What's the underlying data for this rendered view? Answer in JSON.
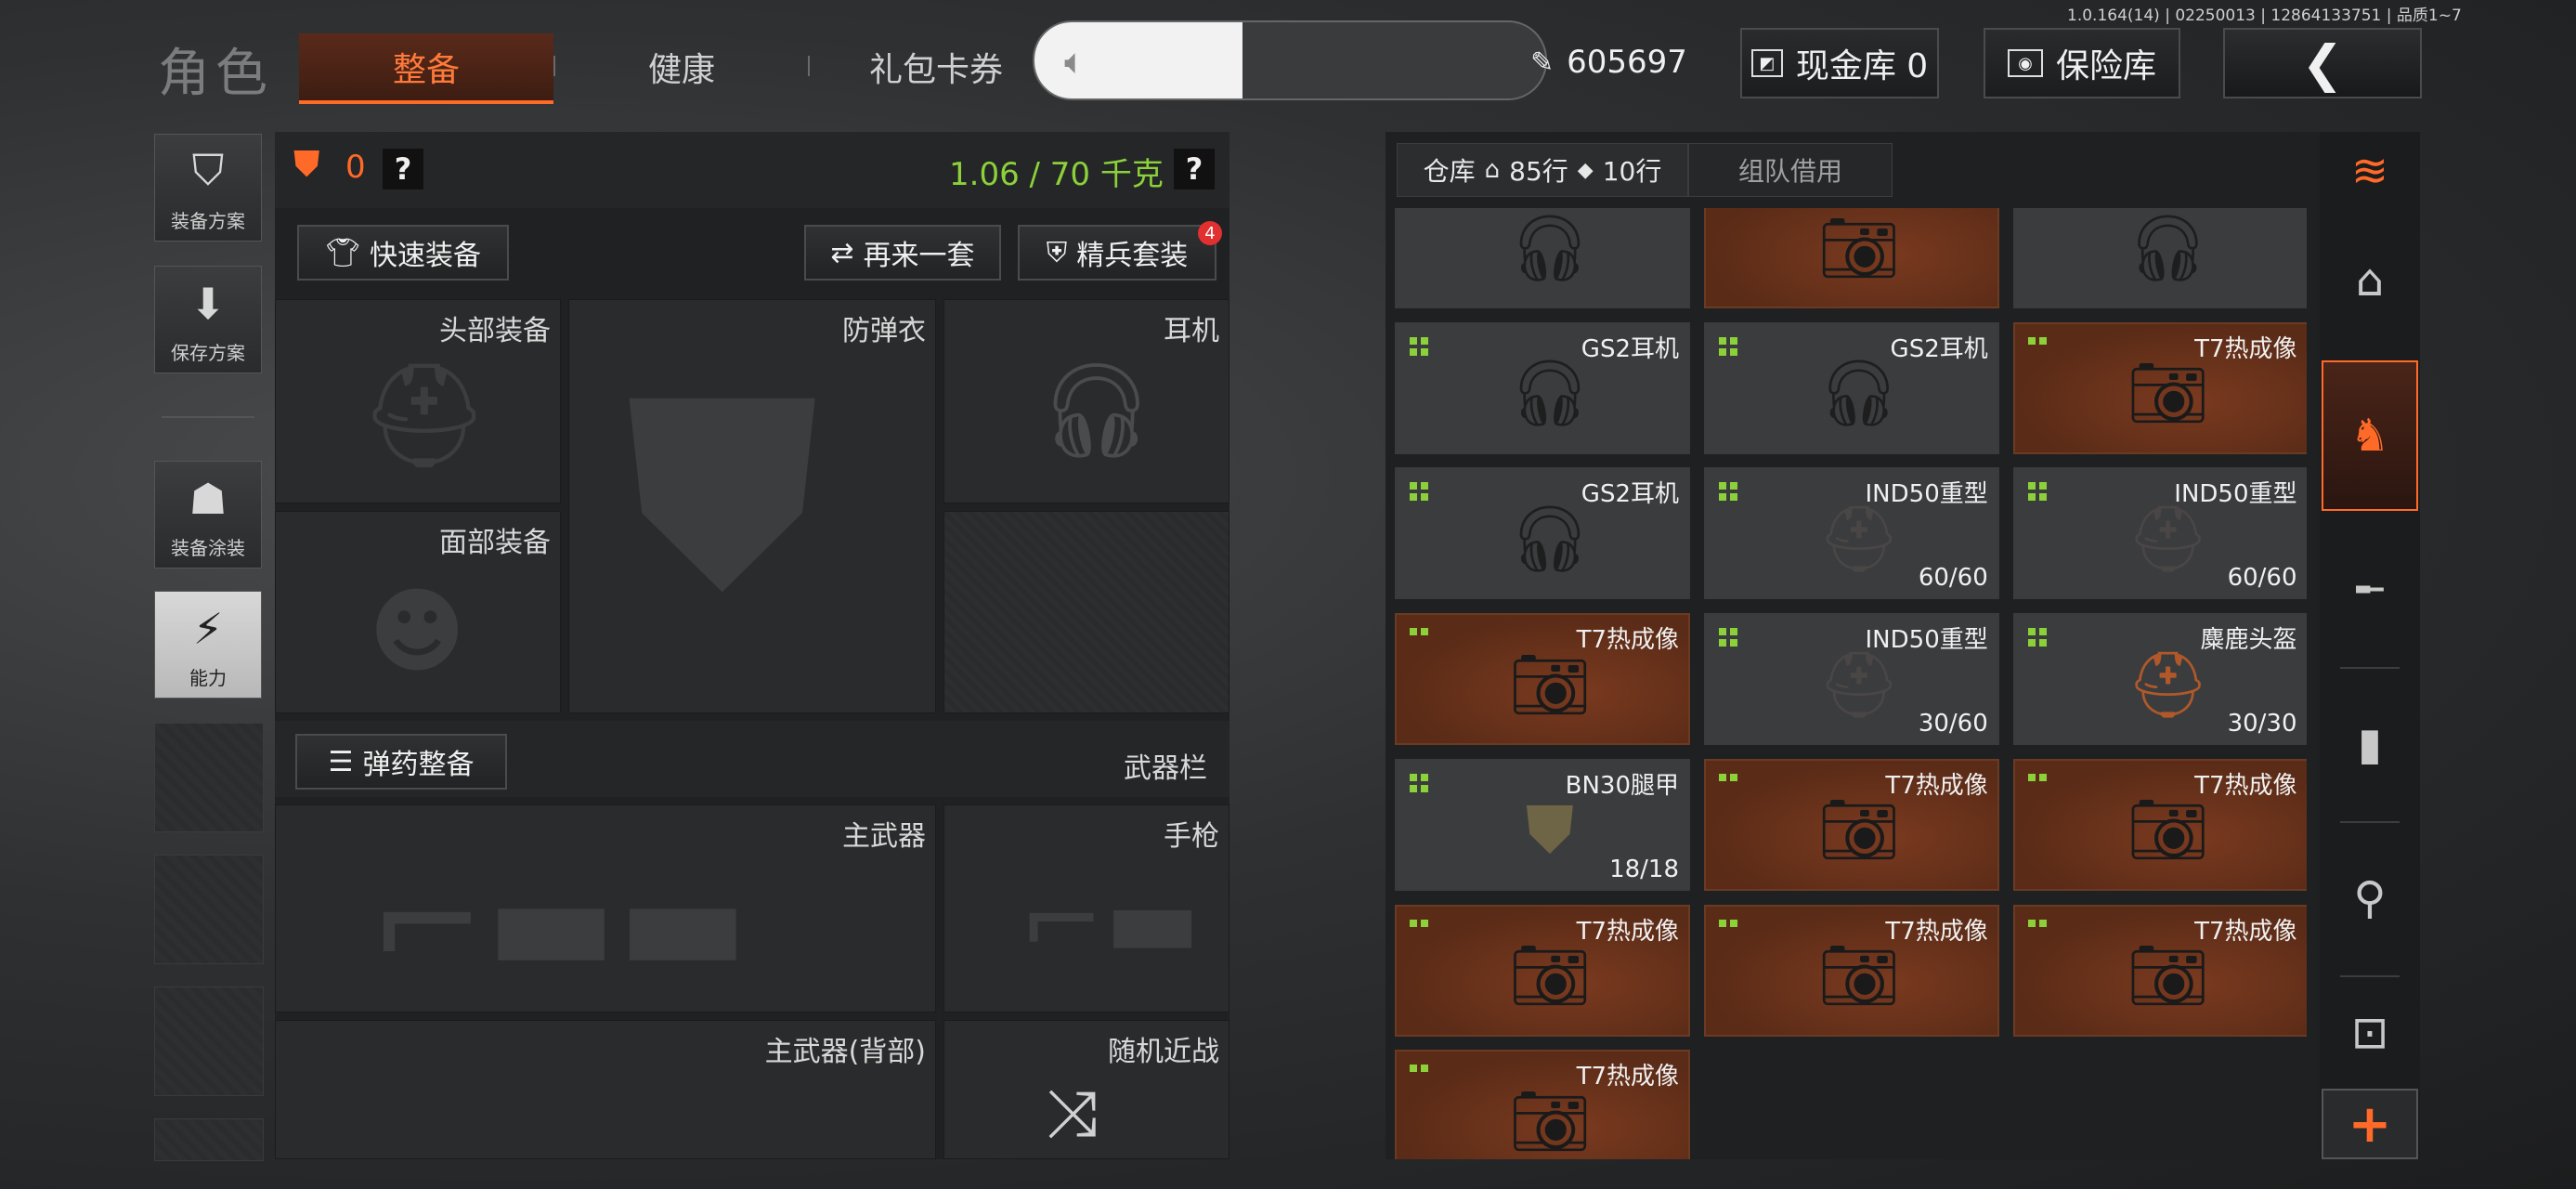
{
  "header": {
    "role_title": "角色",
    "tabs": [
      "整备",
      "健康",
      "礼包卡券"
    ],
    "active_tab": 0,
    "version": "1.0.164(14) | 02250013 | 12864133751 | 品质1~7",
    "currency": "605697",
    "cash_vault_label": "现金库 0",
    "safe_label": "保险库",
    "volume_icon": "speaker-icon",
    "back_icon": "chevron-left-icon"
  },
  "sidebar": [
    {
      "label": "装备方案",
      "icon": "vest-icon"
    },
    {
      "label": "保存方案",
      "icon": "download-icon"
    },
    {
      "label": "装备涂装",
      "icon": "skin-icon"
    },
    {
      "label": "能力",
      "icon": "ability-icon",
      "selected": true
    }
  ],
  "loadout": {
    "backpack_count": "0",
    "help": "?",
    "weight": "1.06 / 70 千克",
    "quick_equip": "快速装备",
    "reroll": "再来一套",
    "elite_set": "精兵套装",
    "elite_badge": "4",
    "ammo_btn": "弹药整备",
    "weapon_bar": "武器栏",
    "slots": {
      "head": "头部装备",
      "armor": "防弹衣",
      "headset": "耳机",
      "face": "面部装备",
      "primary": "主武器",
      "pistol": "手枪",
      "primary_back": "主武器(背部)",
      "melee": "随机近战"
    }
  },
  "warehouse": {
    "tab_warehouse": "仓库",
    "rows_home": "85行",
    "rows_tag": "10行",
    "tab_team": "组队借用",
    "items": [
      {
        "name": "",
        "dur": "",
        "type": "headset",
        "orange": false,
        "rarity": "none"
      },
      {
        "name": "",
        "dur": "",
        "type": "nvg",
        "orange": true,
        "rarity": "none"
      },
      {
        "name": "",
        "dur": "",
        "type": "headset",
        "orange": false,
        "rarity": "none"
      },
      {
        "name": "GS2耳机",
        "dur": "",
        "type": "headset",
        "orange": false,
        "rarity": "4"
      },
      {
        "name": "GS2耳机",
        "dur": "",
        "type": "headset",
        "orange": false,
        "rarity": "4"
      },
      {
        "name": "T7热成像",
        "dur": "",
        "type": "nvg",
        "orange": true,
        "rarity": "2"
      },
      {
        "name": "GS2耳机",
        "dur": "",
        "type": "headset",
        "orange": false,
        "rarity": "4"
      },
      {
        "name": "IND50重型",
        "dur": "60/60",
        "type": "helmet",
        "orange": false,
        "rarity": "4"
      },
      {
        "name": "IND50重型",
        "dur": "60/60",
        "type": "helmet",
        "orange": false,
        "rarity": "4"
      },
      {
        "name": "T7热成像",
        "dur": "",
        "type": "nvg",
        "orange": true,
        "rarity": "2"
      },
      {
        "name": "IND50重型",
        "dur": "30/60",
        "type": "helmet",
        "orange": false,
        "rarity": "4"
      },
      {
        "name": "麋鹿头盔",
        "dur": "30/30",
        "type": "elk",
        "orange": false,
        "rarity": "4"
      },
      {
        "name": "BN30腿甲",
        "dur": "18/18",
        "type": "legarmor",
        "orange": false,
        "rarity": "4"
      },
      {
        "name": "T7热成像",
        "dur": "",
        "type": "nvg",
        "orange": true,
        "rarity": "2"
      },
      {
        "name": "T7热成像",
        "dur": "",
        "type": "nvg",
        "orange": true,
        "rarity": "2"
      },
      {
        "name": "T7热成像",
        "dur": "",
        "type": "nvg",
        "orange": true,
        "rarity": "2"
      },
      {
        "name": "T7热成像",
        "dur": "",
        "type": "nvg",
        "orange": true,
        "rarity": "2"
      },
      {
        "name": "T7热成像",
        "dur": "",
        "type": "nvg",
        "orange": true,
        "rarity": "2"
      },
      {
        "name": "T7热成像",
        "dur": "",
        "type": "nvg",
        "orange": true,
        "rarity": "2"
      }
    ]
  },
  "rail": [
    "stack-refresh-icon",
    "home-icon",
    "deer-icon",
    "rifle-icon",
    "magazine-icon",
    "ammo-icon",
    "sight-icon"
  ],
  "rail_add": "+",
  "colors": {
    "accent": "#ff6a28",
    "green": "#8cd13a"
  }
}
